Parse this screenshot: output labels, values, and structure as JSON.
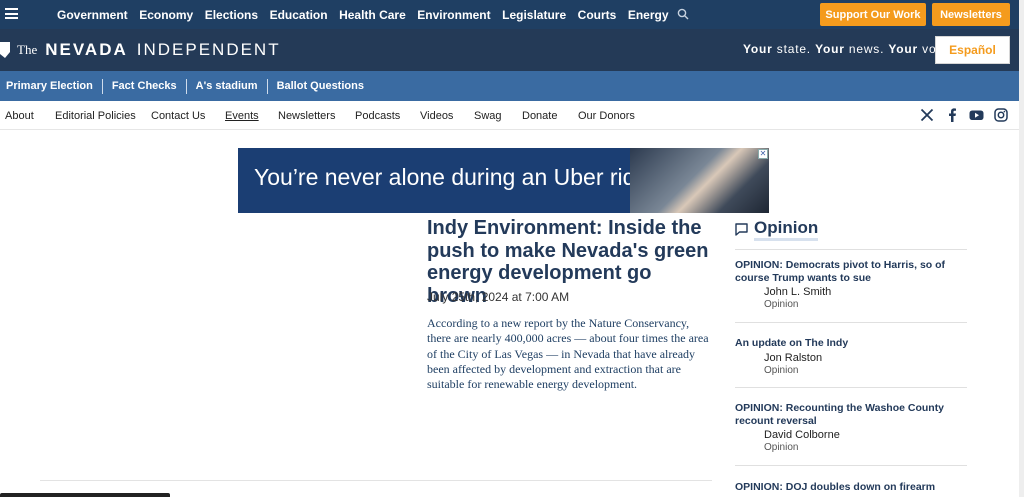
{
  "topnav": {
    "items": [
      "Government",
      "Economy",
      "Elections",
      "Education",
      "Health Care",
      "Environment",
      "Legislature",
      "Courts",
      "Energy"
    ],
    "support_label": "Support Our Work",
    "newsletters_label": "Newsletters",
    "accent_color": "#f49b1d"
  },
  "masthead": {
    "logo_the": "The",
    "logo_nevada": "NEVADA",
    "logo_independent": "INDEPENDENT",
    "tagline": [
      "Your",
      " state. ",
      "Your",
      " news. ",
      "Your",
      " voice."
    ],
    "espanol_label": "Español"
  },
  "tagbar": {
    "items": [
      "Primary Election",
      "Fact Checks",
      "A's stadium",
      "Ballot Questions"
    ]
  },
  "subnav": {
    "items": [
      "About",
      "Editorial Policies",
      "Contact Us",
      "Events",
      "Newsletters",
      "Podcasts",
      "Videos",
      "Swag",
      "Donate",
      "Our Donors"
    ]
  },
  "ad": {
    "text": "You’re never alone during an Uber ride."
  },
  "article": {
    "headline": "Indy Environment: Inside the push to make Nevada's green energy development go brown",
    "date": "July 25th, 2024 at 7:00 AM",
    "excerpt": "According to a new report by the Nature Conservancy, there are nearly 400,000 acres — about four times the area of the City of Las Vegas — in Nevada that have already been affected by development and extraction that are suitable for renewable energy development."
  },
  "opinion": {
    "title": "Opinion",
    "items": [
      {
        "headline": "OPINION: Democrats pivot to Harris, so of course Trump wants to sue",
        "author": "John L. Smith",
        "category": "Opinion"
      },
      {
        "headline": "An update on The Indy",
        "author": "Jon Ralston",
        "category": "Opinion"
      },
      {
        "headline": "OPINION: Recounting the Washoe County recount reversal",
        "author": "David Colborne",
        "category": "Opinion"
      },
      {
        "headline": "OPINION: DOJ doubles down on firearm",
        "author": "",
        "category": ""
      }
    ]
  }
}
